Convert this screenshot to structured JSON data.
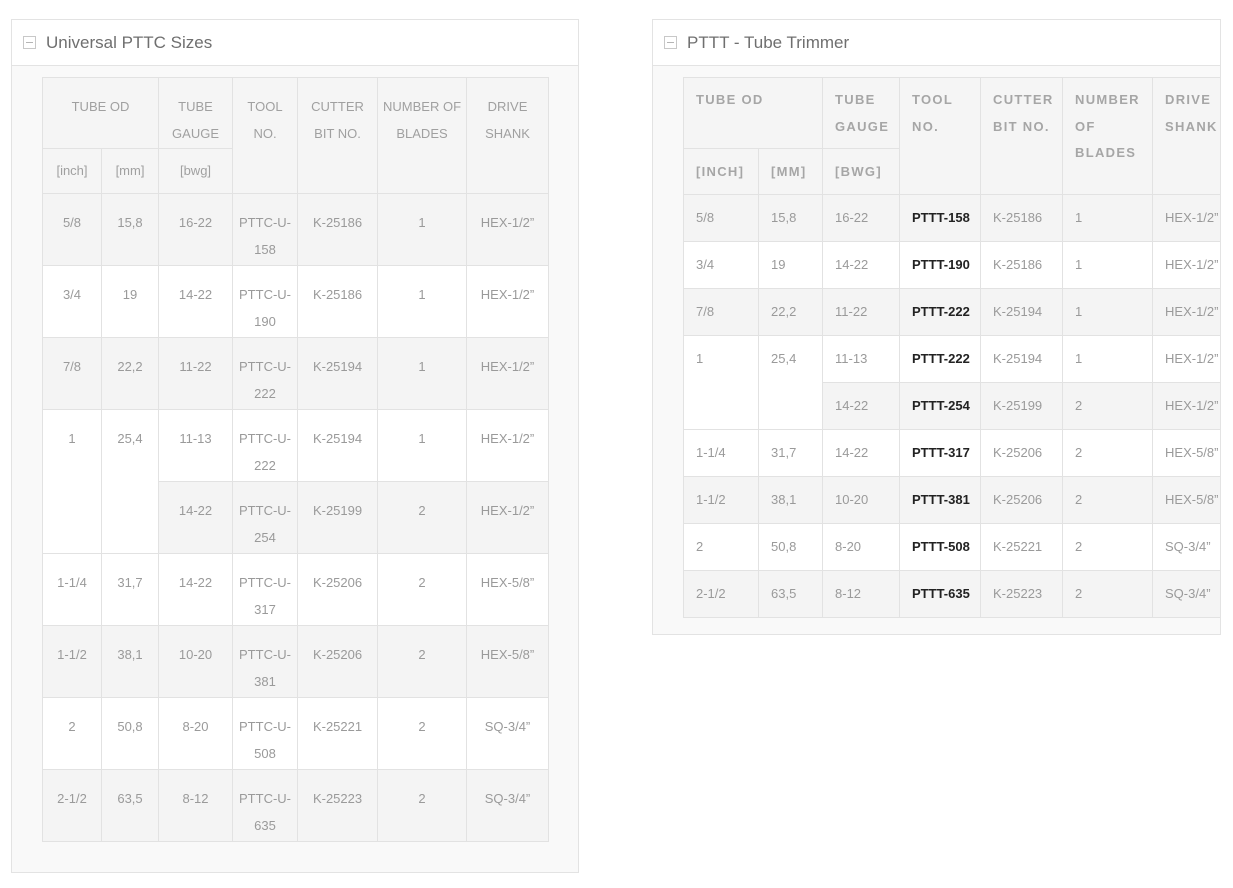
{
  "left": {
    "title": "Universal PTTC Sizes",
    "headers": {
      "tube_od": "TUBE OD",
      "tube_gauge": "TUBE GAUGE",
      "tool_no": "TOOL NO.",
      "cutter_bit_no": "CUTTER BIT NO.",
      "number_of_blades": "NUMBER OF BLADES",
      "drive_shank": "DRIVE SHANK",
      "inch": "[inch]",
      "mm": "[mm]",
      "bwg": "[bwg]"
    },
    "rows": [
      {
        "inch": "5/8",
        "mm": "15,8",
        "gauge": "16-22",
        "tool": "PTTC-U-158",
        "bit": "K-25186",
        "blades": "1",
        "shank": "HEX-1/2”"
      },
      {
        "inch": "3/4",
        "mm": "19",
        "gauge": "14-22",
        "tool": "PTTC-U-190",
        "bit": "K-25186",
        "blades": "1",
        "shank": "HEX-1/2”"
      },
      {
        "inch": "7/8",
        "mm": "22,2",
        "gauge": "11-22",
        "tool": "PTTC-U-222",
        "bit": "K-25194",
        "blades": "1",
        "shank": "HEX-1/2”"
      },
      {
        "inch": "1",
        "mm": "25,4",
        "gauge": "11-13",
        "tool": "PTTC-U-222",
        "bit": "K-25194",
        "blades": "1",
        "shank": "HEX-1/2”"
      },
      {
        "inch": "",
        "mm": "",
        "gauge": "14-22",
        "tool": "PTTC-U-254",
        "bit": "K-25199",
        "blades": "2",
        "shank": "HEX-1/2”"
      },
      {
        "inch": "1-1/4",
        "mm": "31,7",
        "gauge": "14-22",
        "tool": "PTTC-U-317",
        "bit": "K-25206",
        "blades": "2",
        "shank": "HEX-5/8”"
      },
      {
        "inch": "1-1/2",
        "mm": "38,1",
        "gauge": "10-20",
        "tool": "PTTC-U-381",
        "bit": "K-25206",
        "blades": "2",
        "shank": "HEX-5/8”"
      },
      {
        "inch": "2",
        "mm": "50,8",
        "gauge": "8-20",
        "tool": "PTTC-U-508",
        "bit": "K-25221",
        "blades": "2",
        "shank": "SQ-3/4”"
      },
      {
        "inch": "2-1/2",
        "mm": "63,5",
        "gauge": "8-12",
        "tool": "PTTC-U-635",
        "bit": "K-25223",
        "blades": "2",
        "shank": "SQ-3/4”"
      }
    ]
  },
  "right": {
    "title": "PTTT - Tube Trimmer",
    "headers": {
      "tube_od": "TUBE OD",
      "tube_gauge": "TUBE GAUGE",
      "tool_no": "TOOL NO.",
      "cutter_bit_no": "CUTTER BIT NO.",
      "number_of_blades": "NUMBER OF BLADES",
      "drive_shank": "DRIVE SHANK",
      "inch": "[INCH]",
      "mm": "[MM]",
      "bwg": "[BWG]"
    },
    "rows": [
      {
        "inch": "5/8",
        "mm": "15,8",
        "gauge": "16-22",
        "tool": "PTTT-158",
        "bit": "K-25186",
        "blades": "1",
        "shank": "HEX-1/2”"
      },
      {
        "inch": "3/4",
        "mm": "19",
        "gauge": "14-22",
        "tool": "PTTT-190",
        "bit": "K-25186",
        "blades": "1",
        "shank": "HEX-1/2”"
      },
      {
        "inch": "7/8",
        "mm": "22,2",
        "gauge": "11-22",
        "tool": "PTTT-222",
        "bit": "K-25194",
        "blades": "1",
        "shank": "HEX-1/2”"
      },
      {
        "inch": "1",
        "mm": "25,4",
        "gauge": "11-13",
        "tool": "PTTT-222",
        "bit": "K-25194",
        "blades": "1",
        "shank": "HEX-1/2”"
      },
      {
        "inch": "",
        "mm": "",
        "gauge": "14-22",
        "tool": "PTTT-254",
        "bit": "K-25199",
        "blades": "2",
        "shank": "HEX-1/2”"
      },
      {
        "inch": "1-1/4",
        "mm": "31,7",
        "gauge": "14-22",
        "tool": "PTTT-317",
        "bit": "K-25206",
        "blades": "2",
        "shank": "HEX-5/8”"
      },
      {
        "inch": "1-1/2",
        "mm": "38,1",
        "gauge": "10-20",
        "tool": "PTTT-381",
        "bit": "K-25206",
        "blades": "2",
        "shank": "HEX-5/8”"
      },
      {
        "inch": "2",
        "mm": "50,8",
        "gauge": "8-20",
        "tool": "PTTT-508",
        "bit": "K-25221",
        "blades": "2",
        "shank": "SQ-3/4”"
      },
      {
        "inch": "2-1/2",
        "mm": "63,5",
        "gauge": "8-12",
        "tool": "PTTT-635",
        "bit": "K-25223",
        "blades": "2",
        "shank": "SQ-3/4”"
      }
    ]
  }
}
